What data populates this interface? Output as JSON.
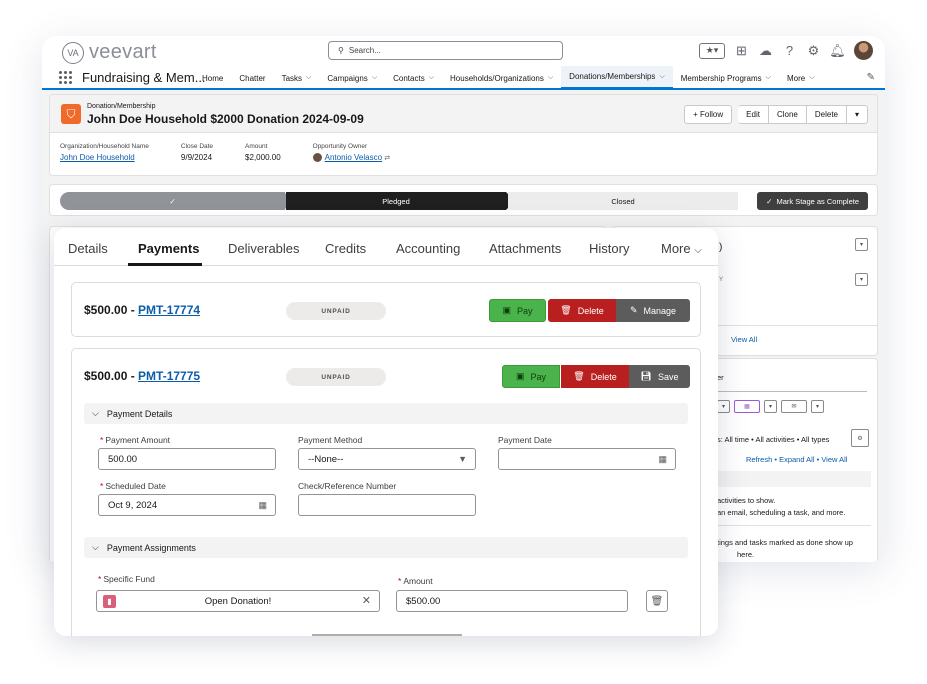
{
  "header": {
    "logo_mark": "VA",
    "logo_text": "veevart",
    "search_placeholder": "Search...",
    "icons": [
      "favorites-icon",
      "add-icon",
      "trailhead-icon",
      "help-icon",
      "setup-gear-icon",
      "bell-icon",
      "avatar"
    ]
  },
  "nav": {
    "app_name": "Fundraising & Mem...",
    "items": [
      {
        "label": "Home",
        "dropdown": false
      },
      {
        "label": "Chatter",
        "dropdown": false
      },
      {
        "label": "Tasks",
        "dropdown": true
      },
      {
        "label": "Campaigns",
        "dropdown": true
      },
      {
        "label": "Contacts",
        "dropdown": true
      },
      {
        "label": "Households/Organizations",
        "dropdown": true
      },
      {
        "label": "Donations/Memberships",
        "dropdown": true,
        "active": true
      },
      {
        "label": "Membership Programs",
        "dropdown": true
      },
      {
        "label": "More",
        "dropdown": true
      }
    ]
  },
  "record": {
    "type": "Donation/Membership",
    "title": "John Doe Household $2000 Donation 2024-09-09",
    "buttons": {
      "follow": "Follow",
      "edit": "Edit",
      "clone": "Clone",
      "delete": "Delete"
    },
    "fields": {
      "org_label": "Organization/Household Name",
      "org_value": "John Doe Household",
      "close_label": "Close Date",
      "close_value": "9/9/2024",
      "amount_label": "Amount",
      "amount_value": "$2,000.00",
      "owner_label": "Opportunity Owner",
      "owner_value": "Antonio Velasco"
    }
  },
  "path": {
    "stages": [
      "Pledged",
      "Closed"
    ],
    "mark_complete": "Mark Stage as Complete"
  },
  "right_panel": {
    "view_all": "View All",
    "filter_text": "s: All time • All activities • All types",
    "refresh": "Refresh",
    "expand_all": "Expand All",
    "view_all2": "View All",
    "empty_1": "activities to show.",
    "empty_2": "an email, scheduling a task, and more.",
    "empty_3": "tings and tasks marked as done show up",
    "empty_4": "here.",
    "label_er": "er",
    "label_y": "Y"
  },
  "tabs": {
    "details": "Details",
    "payments": "Payments",
    "deliverables": "Deliverables",
    "credits": "Credits",
    "accounting": "Accounting",
    "attachments": "Attachments",
    "history": "History",
    "more": "More"
  },
  "payment1": {
    "amount": "$500.00 - ",
    "id": "PMT-17774",
    "status": "UNPAID",
    "pay": "Pay",
    "delete": "Delete",
    "manage": "Manage"
  },
  "payment2": {
    "amount": "$500.00 - ",
    "id": "PMT-17775",
    "status": "UNPAID",
    "pay": "Pay",
    "delete": "Delete",
    "save": "Save",
    "details_section": "Payment Details",
    "fields": {
      "payment_amount_label": "Payment Amount",
      "payment_amount_value": "500.00",
      "payment_method_label": "Payment Method",
      "payment_method_value": "--None--",
      "payment_date_label": "Payment Date",
      "payment_date_value": "",
      "scheduled_date_label": "Scheduled Date",
      "scheduled_date_value": "Oct 9, 2024",
      "check_ref_label": "Check/Reference Number",
      "check_ref_value": ""
    },
    "assign_section": "Payment Assignments",
    "assign": {
      "fund_label": "Specific Fund",
      "fund_value": "Open Donation!",
      "amount_label": "Amount",
      "amount_value": "$500.00"
    }
  },
  "colors": {
    "brand_blue": "#0176d3",
    "pay_green": "#4bb34b",
    "delete_red": "#ba1f1f",
    "manage_gray": "#5c5c5c",
    "record_icon": "#f06a2a"
  }
}
